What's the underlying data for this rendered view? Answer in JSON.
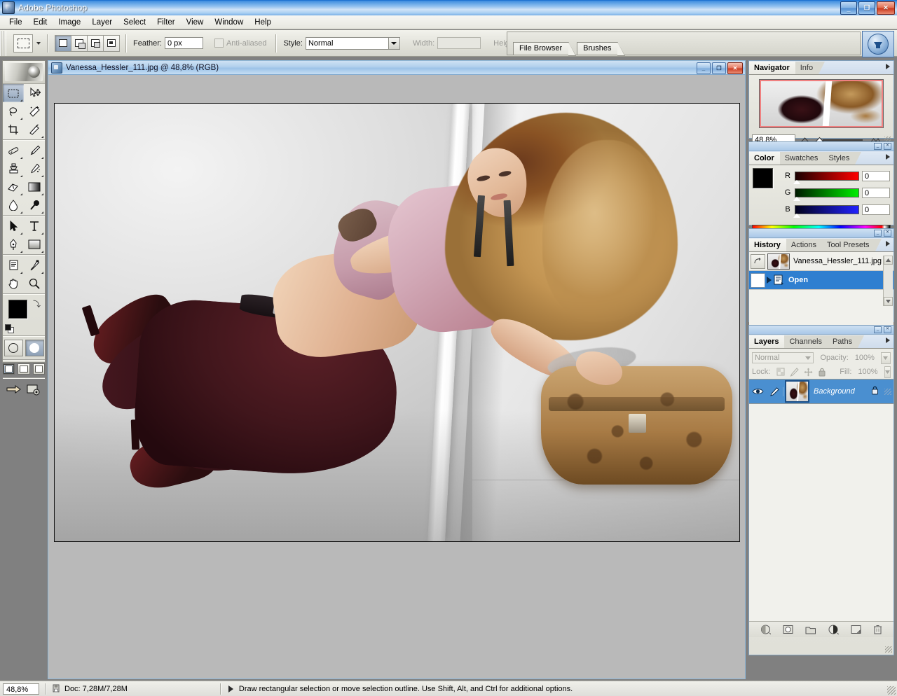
{
  "app": {
    "title": "Adobe Photoshop",
    "icon": "photoshop-icon",
    "window_buttons": {
      "minimize": "_",
      "restore": "❐",
      "close": "✕"
    }
  },
  "menubar": {
    "items": [
      {
        "label": "File"
      },
      {
        "label": "Edit"
      },
      {
        "label": "Image"
      },
      {
        "label": "Layer"
      },
      {
        "label": "Select"
      },
      {
        "label": "Filter"
      },
      {
        "label": "View"
      },
      {
        "label": "Window"
      },
      {
        "label": "Help"
      }
    ]
  },
  "options_bar": {
    "tool_icon": "rectangular-marquee-icon",
    "selection_modes": [
      "new-selection",
      "add-to-selection",
      "subtract-from-selection",
      "intersect-with-selection"
    ],
    "selected_mode_index": 0,
    "feather_label": "Feather:",
    "feather_value": "0 px",
    "antialiased_label": "Anti-aliased",
    "antialiased_checked": false,
    "style_label": "Style:",
    "style_value": "Normal",
    "width_label": "Width:",
    "width_value": "",
    "height_label": "Height:",
    "height_value": "",
    "palette_well": [
      {
        "label": "File Browser"
      },
      {
        "label": "Brushes"
      }
    ],
    "jump_to_button": "jump-to-imageready-icon"
  },
  "toolbox": {
    "tools": [
      {
        "name": "rectangular-marquee-tool",
        "active": true
      },
      {
        "name": "move-tool",
        "active": false
      },
      {
        "name": "lasso-tool",
        "active": false
      },
      {
        "name": "magic-wand-tool",
        "active": false
      },
      {
        "name": "crop-tool",
        "active": false
      },
      {
        "name": "slice-tool",
        "active": false
      },
      {
        "name": "healing-brush-tool",
        "active": false
      },
      {
        "name": "brush-tool",
        "active": false
      },
      {
        "name": "clone-stamp-tool",
        "active": false
      },
      {
        "name": "history-brush-tool",
        "active": false
      },
      {
        "name": "eraser-tool",
        "active": false
      },
      {
        "name": "gradient-tool",
        "active": false
      },
      {
        "name": "blur-tool",
        "active": false
      },
      {
        "name": "dodge-tool",
        "active": false
      },
      {
        "name": "path-selection-tool",
        "active": false
      },
      {
        "name": "type-tool",
        "active": false
      },
      {
        "name": "pen-tool",
        "active": false
      },
      {
        "name": "rectangle-shape-tool",
        "active": false
      },
      {
        "name": "notes-tool",
        "active": false
      },
      {
        "name": "eyedropper-tool",
        "active": false
      },
      {
        "name": "hand-tool",
        "active": false
      },
      {
        "name": "zoom-tool",
        "active": false
      }
    ],
    "foreground_color": "#000000",
    "background_color": "#ffffff",
    "quick_mask_modes": [
      "standard-mode",
      "quick-mask-mode"
    ],
    "screen_modes": [
      "standard-screen-mode",
      "full-screen-with-menu-bar",
      "full-screen-mode"
    ],
    "imageready_buttons": [
      "jump-to-imageready",
      "edit-in-imageready"
    ]
  },
  "document": {
    "icon": "document-icon",
    "title": "Vanessa_Hessler_111.jpg @ 48,8% (RGB)",
    "filename": "Vanessa_Hessler_111.jpg",
    "zoom": "48,8%",
    "mode": "RGB",
    "window_buttons": {
      "minimize": "_",
      "maximize": "❐",
      "close": "✕"
    }
  },
  "navigator": {
    "tabs": [
      {
        "label": "Navigator",
        "active": true
      },
      {
        "label": "Info",
        "active": false
      }
    ],
    "zoom_value": "48,8%",
    "zoom_out_icon": "zoom-out-icon",
    "zoom_in_icon": "zoom-in-icon",
    "view_box_color": "#f08080"
  },
  "color_panel": {
    "tabs": [
      {
        "label": "Color",
        "active": true
      },
      {
        "label": "Swatches",
        "active": false
      },
      {
        "label": "Styles",
        "active": false
      }
    ],
    "channels": [
      {
        "label": "R",
        "value": "0"
      },
      {
        "label": "G",
        "value": "0"
      },
      {
        "label": "B",
        "value": "0"
      }
    ],
    "foreground": "#000000",
    "background": "#ffffff"
  },
  "history_panel": {
    "tabs": [
      {
        "label": "History",
        "active": true
      },
      {
        "label": "Actions",
        "active": false
      },
      {
        "label": "Tool Presets",
        "active": false
      }
    ],
    "snapshot": {
      "label": "Vanessa_Hessler_111.jpg"
    },
    "states": [
      {
        "label": "Open",
        "selected": true
      }
    ],
    "footer_icons": [
      "create-document-from-state-icon",
      "create-snapshot-icon",
      "delete-state-icon"
    ]
  },
  "layers_panel": {
    "tabs": [
      {
        "label": "Layers",
        "active": true
      },
      {
        "label": "Channels",
        "active": false
      },
      {
        "label": "Paths",
        "active": false
      }
    ],
    "blend_mode": "Normal",
    "opacity_label": "Opacity:",
    "opacity_value": "100%",
    "lock_label": "Lock:",
    "lock_icons": [
      "lock-transparent-pixels-icon",
      "lock-image-pixels-icon",
      "lock-position-icon",
      "lock-all-icon"
    ],
    "fill_label": "Fill:",
    "fill_value": "100%",
    "layers": [
      {
        "name": "Background",
        "visible": true,
        "locked": true,
        "selected": true
      }
    ],
    "footer_icons": [
      "link-layers-icon",
      "layer-style-icon",
      "layer-mask-icon",
      "new-group-icon",
      "new-adjustment-layer-icon",
      "new-layer-icon",
      "delete-layer-icon"
    ]
  },
  "status_bar": {
    "zoom": "48,8%",
    "doc_icon": "document-size-icon",
    "doc_info": "Doc: 7,28M/7,28M",
    "hint": "Draw rectangular selection or move selection outline.  Use Shift, Alt, and Ctrl for additional options."
  }
}
